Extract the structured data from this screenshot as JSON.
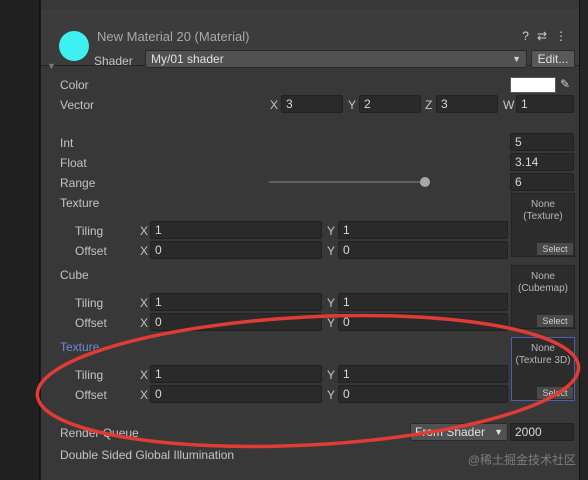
{
  "header": {
    "title": "New Material 20 (Material)",
    "help_icon": "?",
    "settings_icon": "⇄",
    "more_icon": "⋮",
    "shader_label": "Shader",
    "shader_value": "My/01 shader",
    "edit_label": "Edit...",
    "swatch_color": "#3ff0f0"
  },
  "props": {
    "color": {
      "label": "Color",
      "value_color": "#ffffff"
    },
    "vector": {
      "label": "Vector",
      "x_axis": "X",
      "x": "3",
      "y_axis": "Y",
      "y": "2",
      "z_axis": "Z",
      "z": "3",
      "w_axis": "W",
      "w": "1"
    },
    "int": {
      "label": "Int",
      "value": "5"
    },
    "float": {
      "label": "Float",
      "value": "3.14"
    },
    "range": {
      "label": "Range",
      "value": "6",
      "slider_fraction": 0.87
    },
    "texture": {
      "label": "Texture",
      "tiling_label": "Tiling",
      "offset_label": "Offset",
      "x_axis": "X",
      "y_axis": "Y",
      "tiling_x": "1",
      "tiling_y": "1",
      "offset_x": "0",
      "offset_y": "0",
      "slot_text": "None\n(Texture)",
      "select_label": "Select"
    },
    "cube": {
      "label": "Cube",
      "tiling_label": "Tiling",
      "offset_label": "Offset",
      "x_axis": "X",
      "y_axis": "Y",
      "tiling_x": "1",
      "tiling_y": "1",
      "offset_x": "0",
      "offset_y": "0",
      "slot_text": "None\n(Cubemap)",
      "select_label": "Select"
    },
    "texture3d": {
      "label": "Texture",
      "tiling_label": "Tiling",
      "offset_label": "Offset",
      "x_axis": "X",
      "y_axis": "Y",
      "tiling_x": "1",
      "tiling_y": "1",
      "offset_x": "0",
      "offset_y": "0",
      "slot_text": "None\n(Texture 3D)",
      "select_label": "Select"
    },
    "render_queue": {
      "label": "Render Queue",
      "mode": "From Shader",
      "value": "2000"
    },
    "double_sided_gi": {
      "label": "Double Sided Global Illumination"
    }
  },
  "annotation": {
    "ellipse_color": "#e03c35"
  },
  "watermark": "@稀土掘金技术社区"
}
